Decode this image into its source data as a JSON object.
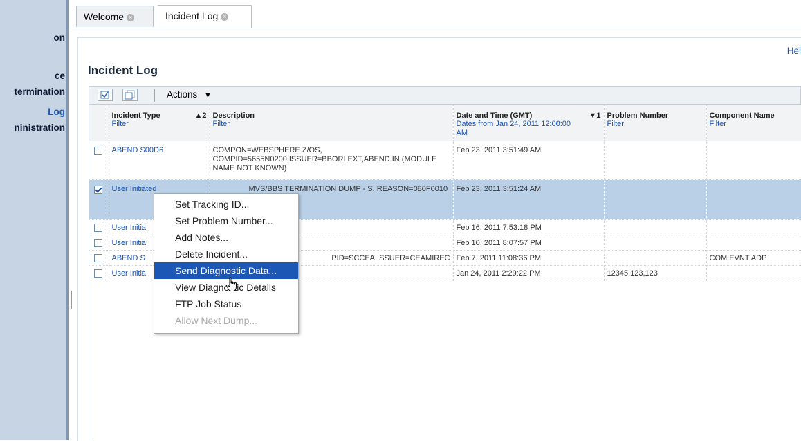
{
  "sidebar": {
    "items": [
      {
        "label": "on"
      },
      {
        "label": "ce"
      },
      {
        "label": "termination"
      },
      {
        "label": "Log"
      },
      {
        "label": "ninistration"
      }
    ]
  },
  "tabs": [
    {
      "label": "Welcome",
      "active": false
    },
    {
      "label": "Incident Log",
      "active": true
    }
  ],
  "help_link": "Hel",
  "page_title": "Incident Log",
  "toolbar": {
    "actions_label": "Actions"
  },
  "table": {
    "columns": [
      {
        "label": "Incident Type",
        "sort": "▲2",
        "filter": "Filter"
      },
      {
        "label": "Description",
        "sort": "",
        "filter": "Filter"
      },
      {
        "label": "Date and Time (GMT)",
        "sort": "▼1",
        "filter": "Dates from Jan 24, 2011 12:00:00 AM"
      },
      {
        "label": "Problem Number",
        "sort": "",
        "filter": "Filter"
      },
      {
        "label": "Component Name",
        "sort": "",
        "filter": "Filter"
      }
    ],
    "rows": [
      {
        "checked": false,
        "type": "ABEND S00D6",
        "description": "COMPON=WEBSPHERE Z/OS, COMPID=5655N0200,ISSUER=BBORLEXT,ABEND IN (MODULE NAME NOT KNOWN)",
        "datetime": "Feb 23, 2011 3:51:49 AM",
        "problem": "",
        "component": ""
      },
      {
        "checked": true,
        "type": "User Initiated",
        "description": "MVS/BBS TERMINATION DUMP - S, REASON=080F0010",
        "datetime": "Feb 23, 2011 3:51:24 AM",
        "problem": "",
        "component": ""
      },
      {
        "checked": false,
        "type": "User Initia",
        "description": "",
        "datetime": "Feb 16, 2011 7:53:18 PM",
        "problem": "",
        "component": ""
      },
      {
        "checked": false,
        "type": "User Initia",
        "description": "",
        "datetime": "Feb 10, 2011 8:07:57 PM",
        "problem": "",
        "component": ""
      },
      {
        "checked": false,
        "type": "ABEND S",
        "description": "PID=SCCEA,ISSUER=CEAMIREC",
        "datetime": "Feb 7, 2011 11:08:36 PM",
        "problem": "",
        "component": "COM EVNT ADP"
      },
      {
        "checked": false,
        "type": "User Initia",
        "description": "",
        "datetime": "Jan 24, 2011 2:29:22 PM",
        "problem": "12345,123,123",
        "component": ""
      }
    ]
  },
  "context_menu": {
    "items": [
      {
        "label": "Set Tracking ID...",
        "state": "normal"
      },
      {
        "label": "Set Problem Number...",
        "state": "normal"
      },
      {
        "label": "Add Notes...",
        "state": "normal"
      },
      {
        "label": "Delete Incident...",
        "state": "normal"
      },
      {
        "label": "Send Diagnostic Data...",
        "state": "highlighted"
      },
      {
        "label": "View Diagnostic Details",
        "state": "normal"
      },
      {
        "label": "FTP Job Status",
        "state": "normal"
      },
      {
        "label": "Allow Next Dump...",
        "state": "disabled"
      }
    ]
  },
  "colors": {
    "link": "#1a55b8",
    "selection": "#bad0e6",
    "menu_highlight": "#1d57b5",
    "sidebar": "#c7d4e4"
  },
  "icons": {
    "tab_close": "close-icon",
    "select_all": "select-all-icon",
    "deselect_all": "deselect-all-icon",
    "cursor": "hand-pointer-icon"
  }
}
